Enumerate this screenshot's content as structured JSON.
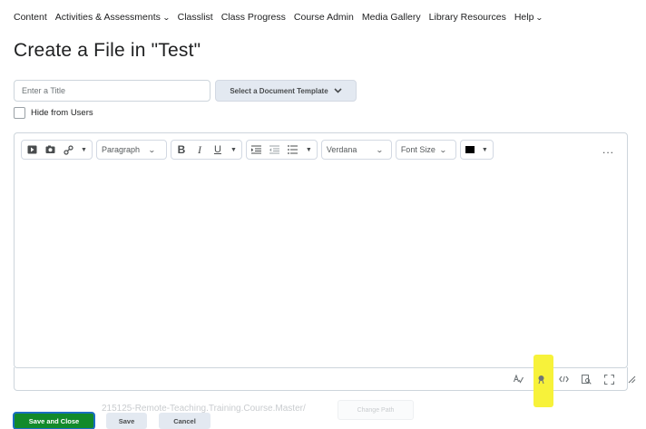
{
  "nav": {
    "items": [
      "Content",
      "Activities & Assessments",
      "Classlist",
      "Class Progress",
      "Course Admin",
      "Media Gallery",
      "Library Resources",
      "Help"
    ]
  },
  "page": {
    "title": "Create a File in \"Test\""
  },
  "form": {
    "title_placeholder": "Enter a Title",
    "template_button": "Select a Document Template",
    "hide_label": "Hide from Users"
  },
  "editor": {
    "paragraph_select": "Paragraph",
    "bold": "B",
    "italic": "I",
    "underline": "U",
    "font_select": "Verdana",
    "size_select": "Font Size",
    "more": "...",
    "text_color": "#000000",
    "bottom_icons": [
      "spellcheck-icon",
      "accessibility-icon",
      "source-code-icon",
      "preview-icon",
      "fullscreen-icon",
      "resize-icon"
    ]
  },
  "footer": {
    "faded_path": "215125-Remote-Teaching.Training.Course.Master/",
    "faded_button": "Change Path",
    "save_close": "Save and Close",
    "save": "Save",
    "cancel": "Cancel"
  },
  "colors": {
    "primary": "#128a2b",
    "highlight": "#f7f23a"
  }
}
